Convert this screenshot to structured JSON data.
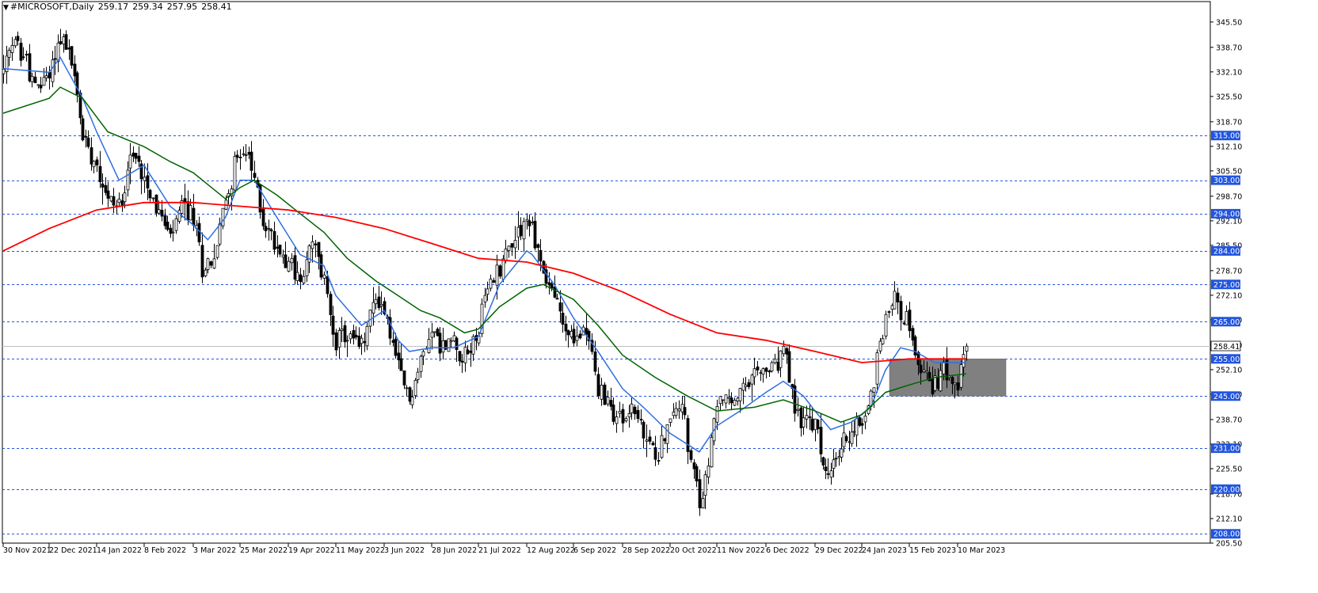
{
  "header": {
    "symbol": "#MICROSOFT,Daily",
    "open": "259.17",
    "high": "259.34",
    "low": "257.95",
    "close": "258.41"
  },
  "chart_data": {
    "type": "candlestick",
    "ylim": [
      205.5,
      349.5
    ],
    "y_ticks": [
      "345.50",
      "338.70",
      "332.10",
      "325.50",
      "318.70",
      "312.10",
      "305.50",
      "298.70",
      "292.10",
      "285.50",
      "278.70",
      "272.10",
      "265.50",
      "258.70",
      "252.10",
      "245.50",
      "238.70",
      "232.10",
      "225.50",
      "218.70",
      "212.10",
      "205.50"
    ],
    "x_ticks": [
      "30 Nov 2021",
      "22 Dec 2021",
      "14 Jan 2022",
      "8 Feb 2022",
      "3 Mar 2022",
      "25 Mar 2022",
      "19 Apr 2022",
      "11 May 2022",
      "3 Jun 2022",
      "28 Jun 2022",
      "21 Jul 2022",
      "12 Aug 2022",
      "6 Sep 2022",
      "28 Sep 2022",
      "20 Oct 2022",
      "11 Nov 2022",
      "6 Dec 2022",
      "29 Dec 2022",
      "24 Jan 2023",
      "15 Feb 2023",
      "10 Mar 2023"
    ],
    "horizontal_levels": [
      {
        "value": 315.0,
        "label": "315.00"
      },
      {
        "value": 303.0,
        "label": "303.00"
      },
      {
        "value": 294.0,
        "label": "294.00"
      },
      {
        "value": 284.0,
        "label": "284.00"
      },
      {
        "value": 275.0,
        "label": "275.00"
      },
      {
        "value": 265.0,
        "label": "265.00"
      },
      {
        "value": 255.0,
        "label": "255.00"
      },
      {
        "value": 245.0,
        "label": "245.00"
      },
      {
        "value": 231.0,
        "label": "231.00"
      },
      {
        "value": 220.0,
        "label": "220.00"
      },
      {
        "value": 208.0,
        "label": "208.00"
      }
    ],
    "current_price": {
      "value": 258.41,
      "label": "258.41"
    },
    "zone": {
      "from": "24 Jan 2023",
      "to": "10 Mar 2023",
      "low": 245.0,
      "high": 255.0,
      "color": "#808080"
    },
    "price_anchors": [
      [
        "30 Nov 2021",
        332
      ],
      [
        "6 Dec 2021",
        340
      ],
      [
        "10 Dec 2021",
        335
      ],
      [
        "15 Dec 2021",
        327
      ],
      [
        "22 Dec 2021",
        332
      ],
      [
        "28 Dec 2021",
        342
      ],
      [
        "3 Jan 2022",
        335
      ],
      [
        "7 Jan 2022",
        315
      ],
      [
        "14 Jan 2022",
        308
      ],
      [
        "20 Jan 2022",
        298
      ],
      [
        "26 Jan 2022",
        296
      ],
      [
        "1 Feb 2022",
        310
      ],
      [
        "8 Feb 2022",
        305
      ],
      [
        "14 Feb 2022",
        296
      ],
      [
        "21 Feb 2022",
        287
      ],
      [
        "25 Feb 2022",
        296
      ],
      [
        "3 Mar 2022",
        293
      ],
      [
        "8 Mar 2022",
        280
      ],
      [
        "14 Mar 2022",
        282
      ],
      [
        "18 Mar 2022",
        298
      ],
      [
        "25 Mar 2022",
        312
      ],
      [
        "29 Mar 2022",
        310
      ],
      [
        "1 Apr 2022",
        303
      ],
      [
        "6 Apr 2022",
        292
      ],
      [
        "13 Apr 2022",
        285
      ],
      [
        "19 Apr 2022",
        282
      ],
      [
        "25 Apr 2022",
        275
      ],
      [
        "29 Apr 2022",
        286
      ],
      [
        "5 May 2022",
        276
      ],
      [
        "11 May 2022",
        260
      ],
      [
        "17 May 2022",
        261
      ],
      [
        "24 May 2022",
        258
      ],
      [
        "31 May 2022",
        272
      ],
      [
        "3 Jun 2022",
        268
      ],
      [
        "10 Jun 2022",
        252
      ],
      [
        "16 Jun 2022",
        244
      ],
      [
        "22 Jun 2022",
        254
      ],
      [
        "28 Jun 2022",
        264
      ],
      [
        "1 Jul 2022",
        258
      ],
      [
        "8 Jul 2022",
        260
      ],
      [
        "14 Jul 2022",
        255
      ],
      [
        "21 Jul 2022",
        263
      ],
      [
        "26 Jul 2022",
        274
      ],
      [
        "1 Aug 2022",
        280
      ],
      [
        "5 Aug 2022",
        287
      ],
      [
        "10 Aug 2022",
        291
      ],
      [
        "12 Aug 2022",
        292
      ],
      [
        "16 Aug 2022",
        290
      ],
      [
        "22 Aug 2022",
        278
      ],
      [
        "26 Aug 2022",
        272
      ],
      [
        "1 Sep 2022",
        263
      ],
      [
        "6 Sep 2022",
        259
      ],
      [
        "12 Sep 2022",
        265
      ],
      [
        "16 Sep 2022",
        246
      ],
      [
        "22 Sep 2022",
        242
      ],
      [
        "28 Sep 2022",
        238
      ],
      [
        "3 Oct 2022",
        243
      ],
      [
        "7 Oct 2022",
        234
      ],
      [
        "13 Oct 2022",
        229
      ],
      [
        "20 Oct 2022",
        238
      ],
      [
        "26 Oct 2022",
        245
      ],
      [
        "28 Oct 2022",
        230
      ],
      [
        "3 Nov 2022",
        216
      ],
      [
        "8 Nov 2022",
        226
      ],
      [
        "11 Nov 2022",
        244
      ],
      [
        "17 Nov 2022",
        243
      ],
      [
        "23 Nov 2022",
        245
      ],
      [
        "30 Nov 2022",
        250
      ],
      [
        "6 Dec 2022",
        252
      ],
      [
        "9 Dec 2022",
        252
      ],
      [
        "14 Dec 2022",
        258
      ],
      [
        "20 Dec 2022",
        241
      ],
      [
        "23 Dec 2022",
        238
      ],
      [
        "29 Dec 2022",
        237
      ],
      [
        "4 Jan 2023",
        224
      ],
      [
        "6 Jan 2023",
        224
      ],
      [
        "12 Jan 2023",
        232
      ],
      [
        "18 Jan 2023",
        236
      ],
      [
        "24 Jan 2023",
        238
      ],
      [
        "27 Jan 2023",
        245
      ],
      [
        "1 Feb 2023",
        260
      ],
      [
        "3 Feb 2023",
        266
      ],
      [
        "8 Feb 2023",
        272
      ],
      [
        "10 Feb 2023",
        268
      ],
      [
        "14 Feb 2023",
        266
      ],
      [
        "15 Feb 2023",
        262
      ],
      [
        "17 Feb 2023",
        255
      ],
      [
        "22 Feb 2023",
        251
      ],
      [
        "28 Feb 2023",
        248
      ],
      [
        "3 Mar 2023",
        252
      ],
      [
        "8 Mar 2023",
        252
      ],
      [
        "10 Mar 2023",
        250
      ],
      [
        "13 Mar 2023",
        255
      ],
      [
        "15 Mar 2023",
        258.41
      ]
    ],
    "series": [
      {
        "name": "",
        "kind": "ma",
        "color": "#2f6fe0",
        "points": [
          [
            "30 Nov 2021",
            333
          ],
          [
            "22 Dec 2021",
            332
          ],
          [
            "28 Dec 2021",
            336
          ],
          [
            "7 Jan 2022",
            325
          ],
          [
            "14 Jan 2022",
            316
          ],
          [
            "26 Jan 2022",
            303
          ],
          [
            "8 Feb 2022",
            307
          ],
          [
            "21 Feb 2022",
            296
          ],
          [
            "3 Mar 2022",
            291
          ],
          [
            "10 Mar 2022",
            287
          ],
          [
            "18 Mar 2022",
            293
          ],
          [
            "25 Mar 2022",
            303
          ],
          [
            "1 Apr 2022",
            303
          ],
          [
            "13 Apr 2022",
            293
          ],
          [
            "25 Apr 2022",
            283
          ],
          [
            "5 May 2022",
            280
          ],
          [
            "11 May 2022",
            272
          ],
          [
            "24 May 2022",
            264
          ],
          [
            "3 Jun 2022",
            268
          ],
          [
            "10 Jun 2022",
            260
          ],
          [
            "16 Jun 2022",
            257
          ],
          [
            "28 Jun 2022",
            258
          ],
          [
            "8 Jul 2022",
            258
          ],
          [
            "21 Jul 2022",
            261
          ],
          [
            "1 Aug 2022",
            275
          ],
          [
            "12 Aug 2022",
            284
          ],
          [
            "16 Aug 2022",
            283
          ],
          [
            "26 Aug 2022",
            275
          ],
          [
            "6 Sep 2022",
            266
          ],
          [
            "16 Sep 2022",
            257
          ],
          [
            "28 Sep 2022",
            247
          ],
          [
            "7 Oct 2022",
            242
          ],
          [
            "20 Oct 2022",
            235
          ],
          [
            "28 Oct 2022",
            232
          ],
          [
            "3 Nov 2022",
            230
          ],
          [
            "11 Nov 2022",
            237
          ],
          [
            "23 Nov 2022",
            241
          ],
          [
            "6 Dec 2022",
            246
          ],
          [
            "14 Dec 2022",
            249
          ],
          [
            "23 Dec 2022",
            245
          ],
          [
            "29 Dec 2022",
            241
          ],
          [
            "6 Jan 2023",
            236
          ],
          [
            "18 Jan 2023",
            238
          ],
          [
            "27 Jan 2023",
            242
          ],
          [
            "3 Feb 2023",
            252
          ],
          [
            "10 Feb 2023",
            258
          ],
          [
            "17 Feb 2023",
            257
          ],
          [
            "28 Feb 2023",
            254
          ],
          [
            "8 Mar 2023",
            254
          ],
          [
            "15 Mar 2023",
            254
          ]
        ]
      },
      {
        "name": "",
        "kind": "ma",
        "color": "#006400",
        "points": [
          [
            "30 Nov 2021",
            321
          ],
          [
            "22 Dec 2021",
            325
          ],
          [
            "28 Dec 2021",
            328
          ],
          [
            "7 Jan 2022",
            325
          ],
          [
            "20 Jan 2022",
            316
          ],
          [
            "8 Feb 2022",
            312
          ],
          [
            "21 Feb 2022",
            308
          ],
          [
            "3 Mar 2022",
            305
          ],
          [
            "18 Mar 2022",
            298
          ],
          [
            "25 Mar 2022",
            301
          ],
          [
            "1 Apr 2022",
            303
          ],
          [
            "13 Apr 2022",
            299
          ],
          [
            "25 Apr 2022",
            294
          ],
          [
            "5 May 2022",
            289
          ],
          [
            "17 May 2022",
            282
          ],
          [
            "31 May 2022",
            276
          ],
          [
            "10 Jun 2022",
            272
          ],
          [
            "22 Jun 2022",
            268
          ],
          [
            "1 Jul 2022",
            266
          ],
          [
            "14 Jul 2022",
            262
          ],
          [
            "21 Jul 2022",
            263
          ],
          [
            "1 Aug 2022",
            269
          ],
          [
            "12 Aug 2022",
            274
          ],
          [
            "22 Aug 2022",
            275
          ],
          [
            "6 Sep 2022",
            271
          ],
          [
            "16 Sep 2022",
            264
          ],
          [
            "28 Sep 2022",
            256
          ],
          [
            "13 Oct 2022",
            250
          ],
          [
            "28 Oct 2022",
            245
          ],
          [
            "11 Nov 2022",
            241
          ],
          [
            "30 Nov 2022",
            242
          ],
          [
            "14 Dec 2022",
            244
          ],
          [
            "29 Dec 2022",
            241
          ],
          [
            "12 Jan 2023",
            238
          ],
          [
            "24 Jan 2023",
            240
          ],
          [
            "3 Feb 2023",
            246
          ],
          [
            "15 Feb 2023",
            248
          ],
          [
            "28 Feb 2023",
            250
          ],
          [
            "15 Mar 2023",
            251
          ]
        ]
      },
      {
        "name": "",
        "kind": "ma",
        "color": "#ff0000",
        "points": [
          [
            "30 Nov 2021",
            284
          ],
          [
            "22 Dec 2021",
            290
          ],
          [
            "14 Jan 2022",
            295
          ],
          [
            "8 Feb 2022",
            297
          ],
          [
            "3 Mar 2022",
            297
          ],
          [
            "25 Mar 2022",
            296
          ],
          [
            "19 Apr 2022",
            295
          ],
          [
            "11 May 2022",
            293
          ],
          [
            "3 Jun 2022",
            290
          ],
          [
            "28 Jun 2022",
            286
          ],
          [
            "21 Jul 2022",
            282
          ],
          [
            "12 Aug 2022",
            281
          ],
          [
            "6 Sep 2022",
            278
          ],
          [
            "28 Sep 2022",
            273
          ],
          [
            "20 Oct 2022",
            267
          ],
          [
            "11 Nov 2022",
            262
          ],
          [
            "6 Dec 2022",
            260
          ],
          [
            "29 Dec 2022",
            257
          ],
          [
            "24 Jan 2023",
            254
          ],
          [
            "15 Feb 2023",
            255
          ],
          [
            "10 Mar 2023",
            255
          ],
          [
            "15 Mar 2023",
            255
          ]
        ]
      }
    ]
  }
}
